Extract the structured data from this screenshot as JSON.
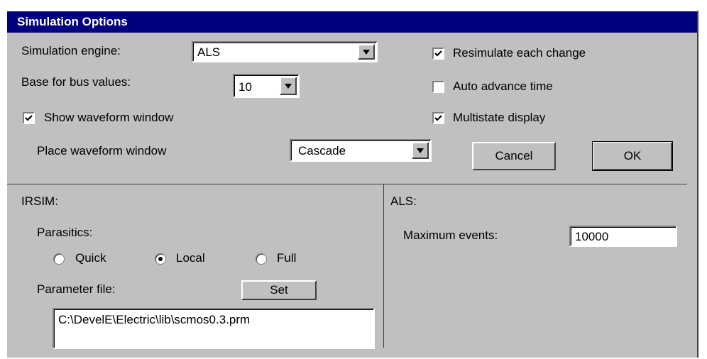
{
  "dialog": {
    "title": "Simulation Options"
  },
  "engine": {
    "label": "Simulation engine:",
    "value": "ALS"
  },
  "bus_base": {
    "label": "Base for bus values:",
    "value": "10"
  },
  "show_waveform": {
    "label": "Show waveform window",
    "checked": true
  },
  "place_waveform": {
    "label": "Place waveform window",
    "value": "Cascade"
  },
  "resimulate": {
    "label": "Resimulate each change",
    "checked": true
  },
  "auto_advance": {
    "label": "Auto advance time",
    "checked": false
  },
  "multistate": {
    "label": "Multistate display",
    "checked": true
  },
  "buttons": {
    "cancel": "Cancel",
    "ok": "OK"
  },
  "irsim": {
    "heading": "IRSIM:",
    "parasitics_label": "Parasitics:",
    "options": [
      "Quick",
      "Local",
      "Full"
    ],
    "selected": "Local",
    "param_file_label": "Parameter file:",
    "set_label": "Set",
    "param_file_path": "C:\\DevelE\\Electric\\lib\\scmos0.3.prm"
  },
  "als": {
    "heading": "ALS:",
    "max_events_label": "Maximum events:",
    "max_events_value": "10000"
  }
}
